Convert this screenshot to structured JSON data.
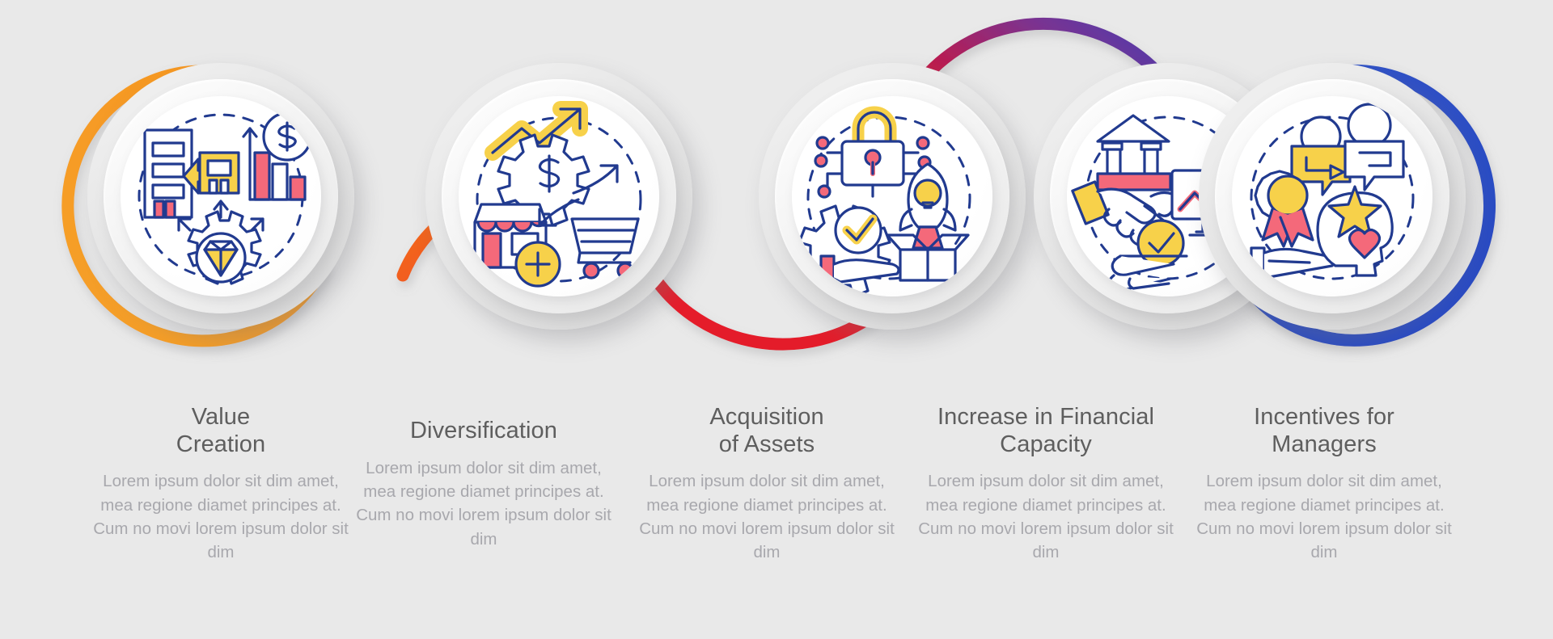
{
  "theme": {
    "background": "#e9e9e9",
    "title_color": "#5e5e5e",
    "body_color": "#a8a8ad",
    "icon_stroke": "#213a8f",
    "icon_yellow": "#f7d14a",
    "icon_pink": "#f4697a"
  },
  "steps": [
    {
      "index": "1",
      "title": "Value\nCreation",
      "description": "Lorem ipsum dolor sit dim amet, mea regione diamet principes at. Cum no movi lorem ipsum dolor sit dim",
      "arc_color_start": "#f5a02a",
      "arc_color_end": "#f58220",
      "icons": [
        "buildings-merge-icon",
        "dollar-coin-icon",
        "bar-chart-icon",
        "gear-diamond-icon"
      ]
    },
    {
      "index": "2",
      "title": "Diversification",
      "description": "Lorem ipsum dolor sit dim amet, mea regione diamet principes at. Cum no movi lorem ipsum dolor sit dim",
      "arc_color_start": "#f4731d",
      "arc_color_end": "#ee2f23",
      "icons": [
        "storefront-icon",
        "gear-dollar-icon",
        "growth-arrow-icon",
        "shopping-cart-icon",
        "plus-circle-icon"
      ]
    },
    {
      "index": "3",
      "title": "Acquisition\nof Assets",
      "description": "Lorem ipsum dolor sit dim amet, mea regione diamet principes at. Cum no movi lorem ipsum dolor sit dim",
      "arc_color_start": "#ec2d26",
      "arc_color_end": "#e01b33",
      "icons": [
        "unlock-network-icon",
        "gear-check-icon",
        "open-hand-icon",
        "rocket-bulb-icon",
        "open-box-icon"
      ]
    },
    {
      "index": "4",
      "title": "Increase in Financial\nCapacity",
      "description": "Lorem ipsum dolor sit dim amet, mea regione diamet principes at. Cum no movi lorem ipsum dolor sit dim",
      "arc_color_start": "#cf1440",
      "arc_color_end": "#3c40b8",
      "icons": [
        "bank-handshake-icon",
        "monitor-growth-icon",
        "dollar-coin-icon",
        "hand-check-icon"
      ]
    },
    {
      "index": "5",
      "title": "Incentives for\nManagers",
      "description": "Lorem ipsum dolor sit dim amet, mea regione diamet principes at. Cum no movi lorem ipsum dolor sit dim",
      "arc_color_start": "#2f52c8",
      "arc_color_end": "#2a4fc6",
      "icons": [
        "award-hand-icon",
        "people-chat-icon",
        "head-star-heart-icon"
      ]
    }
  ]
}
